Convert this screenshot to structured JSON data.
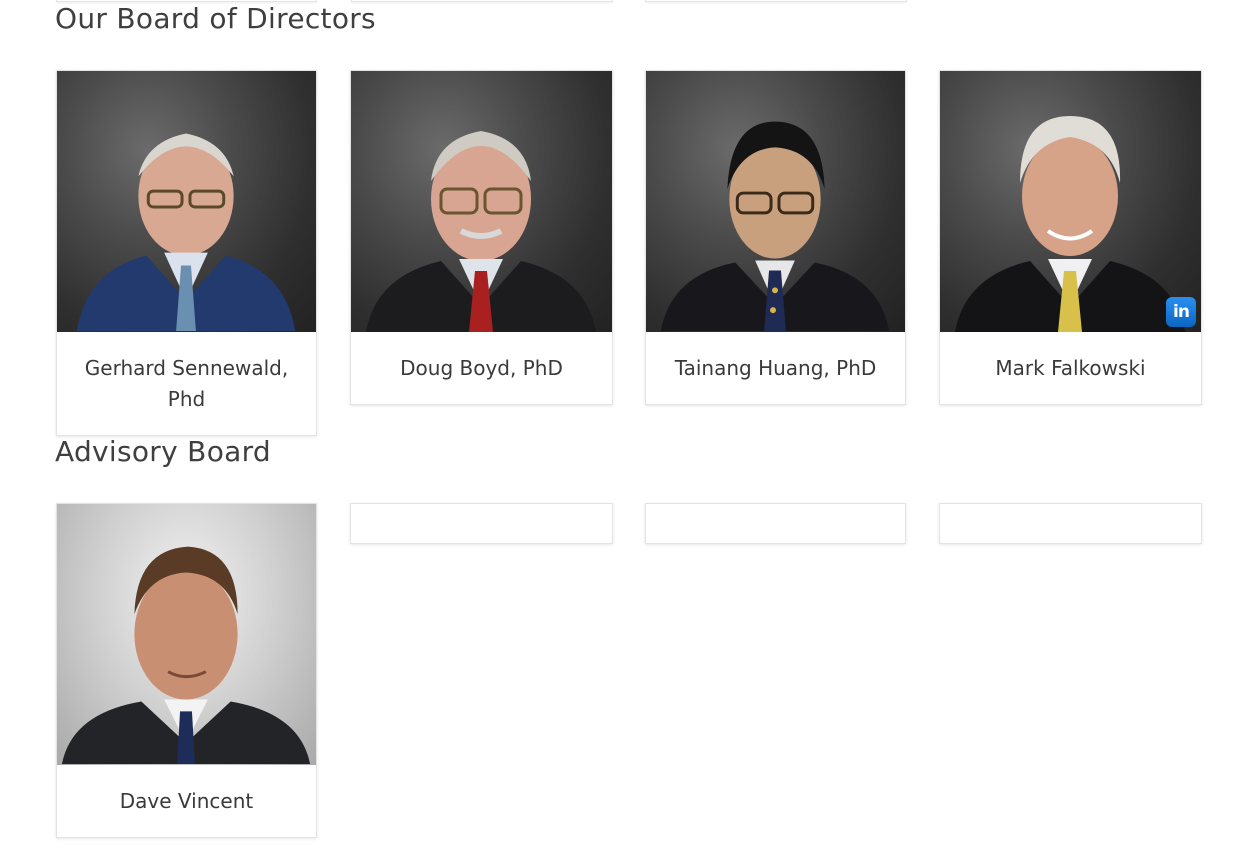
{
  "board": {
    "title": "Our Board of Directors",
    "members": [
      {
        "name": "Gerhard Sennewald, Phd"
      },
      {
        "name": "Doug Boyd, PhD"
      },
      {
        "name": "Tainang Huang, PhD"
      },
      {
        "name": "Mark Falkowski",
        "linkedin_label": "in"
      }
    ]
  },
  "advisory": {
    "title": "Advisory Board",
    "members": [
      {
        "name": "Dave Vincent"
      }
    ]
  },
  "colors": {
    "linkedin": "#0a66c2",
    "heading": "#3f3f3f"
  }
}
